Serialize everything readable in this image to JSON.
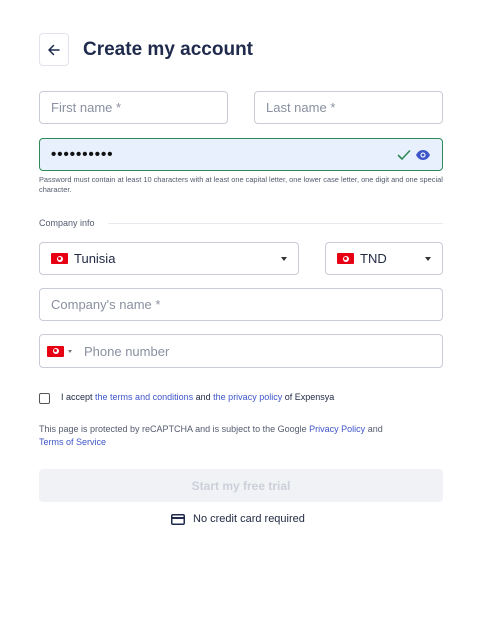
{
  "header": {
    "title": "Create my account",
    "back_icon": "arrow-left-icon"
  },
  "form": {
    "first_name": {
      "placeholder": "First name *",
      "value": ""
    },
    "last_name": {
      "placeholder": "Last name *",
      "value": ""
    },
    "password": {
      "value": "••••••••••",
      "valid_icon": "checkmark-icon",
      "toggle_icon": "eye-icon",
      "hint": "Password must contain at least 10 characters with at least one capital letter, one lower case letter, one digit and one special character."
    },
    "company_section_label": "Company info",
    "country": {
      "selected": "Tunisia",
      "flag": "tunisia-flag"
    },
    "currency": {
      "selected": "TND",
      "flag": "tunisia-flag"
    },
    "company_name": {
      "placeholder": "Company's name *",
      "value": ""
    },
    "phone": {
      "placeholder": "Phone number",
      "value": "",
      "flag": "tunisia-flag"
    },
    "terms": {
      "checked": false,
      "prefix": "I accept",
      "terms_link": "the terms and conditions",
      "and": "and",
      "privacy_link": "the privacy policy",
      "suffix": "of Expensya"
    },
    "recaptcha": {
      "text": "This page is protected by reCAPTCHA and is subject to the Google",
      "privacy_link": "Privacy Policy",
      "and": "and",
      "tos_link": "Terms of Service"
    },
    "submit_label": "Start my free trial",
    "no_card_text": "No credit card required",
    "no_card_icon": "credit-card-icon"
  },
  "colors": {
    "accent": "#3e55c8",
    "valid": "#2e8b57",
    "title": "#1f2a4d",
    "flag_red": "#e70013"
  }
}
